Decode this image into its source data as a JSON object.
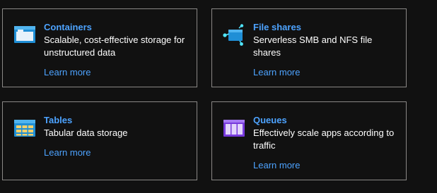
{
  "cards": [
    {
      "title": "Containers",
      "description": "Scalable, cost-effective storage for unstructured data",
      "link": "Learn more",
      "icon": "container-icon"
    },
    {
      "title": "File shares",
      "description": "Serverless SMB and NFS file shares",
      "link": "Learn more",
      "icon": "file-share-icon"
    },
    {
      "title": "Tables",
      "description": "Tabular data storage",
      "link": "Learn more",
      "icon": "table-icon"
    },
    {
      "title": "Queues",
      "description": "Effectively scale apps according to traffic",
      "link": "Learn more",
      "icon": "queue-icon"
    }
  ],
  "colors": {
    "background": "#111111",
    "border": "#8a8886",
    "link": "#4da3ff",
    "text": "#ffffff"
  }
}
